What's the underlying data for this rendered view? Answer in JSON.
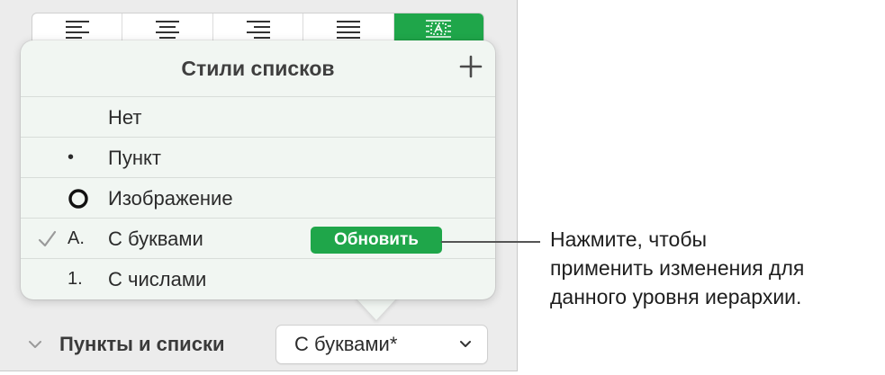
{
  "toolbar": {
    "buttons": [
      {
        "name": "align-left",
        "active": false
      },
      {
        "name": "align-center",
        "active": false
      },
      {
        "name": "align-right",
        "active": false
      },
      {
        "name": "justify",
        "active": false
      },
      {
        "name": "list-style",
        "active": true
      }
    ],
    "active_color": "#1fa64a"
  },
  "popover": {
    "title": "Стили списков",
    "add_icon": "plus-icon",
    "items": [
      {
        "marker": "",
        "label": "Нет",
        "checked": false
      },
      {
        "marker": "•",
        "label": "Пункт",
        "checked": false
      },
      {
        "marker": "circle-image-icon",
        "label": "Изображение",
        "checked": false
      },
      {
        "marker": "A.",
        "label": "С буквами",
        "checked": true
      },
      {
        "marker": "1.",
        "label": "С числами",
        "checked": false
      }
    ],
    "update_button": "Обновить"
  },
  "section": {
    "label": "Пункты и списки",
    "collapse_icon": "chevron-down-icon",
    "selected_style": "С буквами*"
  },
  "callout": {
    "lines": [
      "Нажмите, чтобы",
      "применить изменения для",
      "данного уровня иерархии."
    ]
  },
  "colors": {
    "accent": "#1fa64a",
    "panel_bg": "#ececec",
    "popover_bg": "#f1f6f2"
  }
}
